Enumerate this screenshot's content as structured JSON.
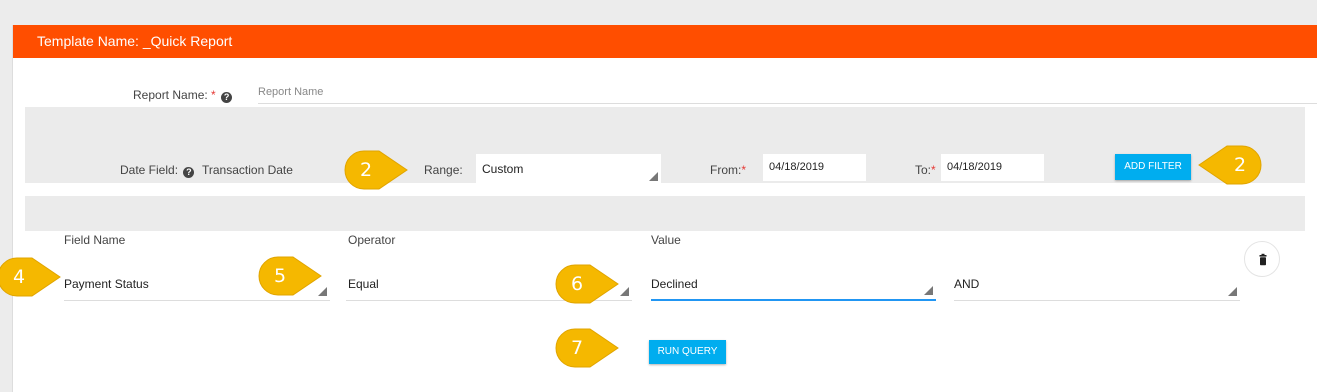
{
  "template_title": "Template Name: _Quick Report",
  "report_name": {
    "label": "Report Name:",
    "required_mark": "*",
    "placeholder": "Report Name",
    "value": ""
  },
  "date_bar": {
    "date_field_label": "Date Field:",
    "date_field_value": "Transaction Date",
    "range_label": "Range:",
    "range_value": "Custom",
    "from_label": "From:",
    "from_value": "04/18/2019",
    "to_label": "To:",
    "to_value": "04/18/2019",
    "required_mark": "*",
    "add_filter_label": "ADD FILTER"
  },
  "filter_table": {
    "headers": [
      "Field Name",
      "Operator",
      "Value"
    ],
    "row": {
      "field_name": "Payment Status",
      "operator": "Equal",
      "value": "Declined",
      "conjunction": "AND"
    }
  },
  "run_query_label": "RUN QUERY",
  "help_glyph": "?",
  "callouts": {
    "range": "2",
    "add_filter": "2",
    "field_name": "4",
    "operator": "5",
    "value": "6",
    "run_query": "7"
  },
  "colors": {
    "header": "#ff4e00",
    "button": "#00adef",
    "callout": "#f5b800",
    "active_underline": "#2196f3"
  }
}
